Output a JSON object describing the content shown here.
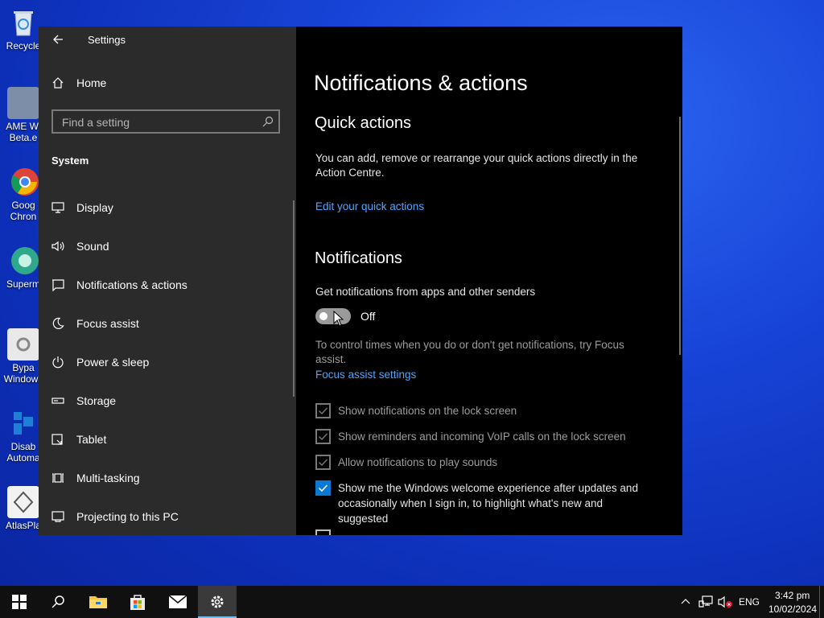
{
  "desktop": {
    "icons": [
      {
        "label": "Recycle"
      },
      {
        "label": "AME Wi Beta.e"
      },
      {
        "label": "Goog Chron"
      },
      {
        "label": "Superm"
      },
      {
        "label": "Bypa Windows"
      },
      {
        "label": "Disab Automa"
      },
      {
        "label": "AtlasPla"
      }
    ]
  },
  "window": {
    "title": "Settings",
    "sidebar": {
      "home_label": "Home",
      "search_placeholder": "Find a setting",
      "section_label": "System",
      "items": [
        {
          "label": "Display",
          "icon": "monitor-icon"
        },
        {
          "label": "Sound",
          "icon": "speaker-icon"
        },
        {
          "label": "Notifications & actions",
          "icon": "notification-icon"
        },
        {
          "label": "Focus assist",
          "icon": "moon-icon"
        },
        {
          "label": "Power & sleep",
          "icon": "power-icon"
        },
        {
          "label": "Storage",
          "icon": "storage-icon"
        },
        {
          "label": "Tablet",
          "icon": "tablet-icon"
        },
        {
          "label": "Multi-tasking",
          "icon": "multitask-icon"
        },
        {
          "label": "Projecting to this PC",
          "icon": "projector-icon"
        }
      ]
    },
    "content": {
      "page_title": "Notifications & actions",
      "quick_actions": {
        "heading": "Quick actions",
        "description": "You can add, remove or rearrange your quick actions directly in the Action Centre.",
        "link": "Edit your quick actions"
      },
      "notifications": {
        "heading": "Notifications",
        "toggle_label": "Get notifications from apps and other senders",
        "toggle_state": "Off",
        "focus_text": "To control times when you do or don't get notifications, try Focus assist.",
        "focus_link": "Focus assist settings",
        "checkboxes": [
          {
            "label": "Show notifications on the lock screen",
            "checked": true,
            "disabled": true
          },
          {
            "label": "Show reminders and incoming VoIP calls on the lock screen",
            "checked": true,
            "disabled": true
          },
          {
            "label": "Allow notifications to play sounds",
            "checked": true,
            "disabled": true
          },
          {
            "label": "Show me the Windows welcome experience after updates and occasionally when I sign in, to highlight what's new and suggested",
            "checked": true,
            "disabled": false
          }
        ]
      }
    }
  },
  "taskbar": {
    "language": "ENG",
    "time": "3:42 pm",
    "date": "10/02/2024"
  },
  "colors": {
    "accent": "#0a78d7",
    "link": "#4ca6ff",
    "sidebar_bg": "#2b2b2b",
    "content_bg": "#000000"
  }
}
